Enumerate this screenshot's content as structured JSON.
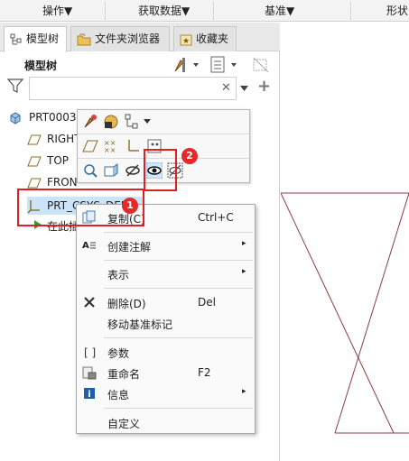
{
  "ribbon": {
    "tabs": [
      {
        "label": "操作▼"
      },
      {
        "label": "获取数据▼"
      },
      {
        "label": "基准▼"
      },
      {
        "label": "形状"
      }
    ]
  },
  "panel_tabs": [
    {
      "label": "模型树",
      "icon": "model-tree-icon"
    },
    {
      "label": "文件夹浏览器",
      "icon": "folder-icon"
    },
    {
      "label": "收藏夹",
      "icon": "favorites-icon"
    }
  ],
  "model_tree": {
    "title": "模型树",
    "search_placeholder": "",
    "items": [
      {
        "label": "PRT0003.",
        "icon": "part-icon"
      },
      {
        "label": "RIGHT",
        "icon": "datum-plane-icon"
      },
      {
        "label": "TOP",
        "icon": "datum-plane-icon"
      },
      {
        "label": "FRON",
        "icon": "datum-plane-icon"
      },
      {
        "label": "PRT_CSYS_DEF",
        "icon": "csys-icon"
      },
      {
        "label": "在此插",
        "icon": "insert-here-icon"
      }
    ]
  },
  "context_menu": {
    "items": [
      {
        "label": "复制(C)",
        "shortcut": "Ctrl+C",
        "icon": "copy-icon"
      },
      {
        "label": "创建注解",
        "submenu": "▸",
        "icon": "annotation-icon"
      },
      {
        "label": "表示",
        "submenu": "▸"
      },
      {
        "label": "删除(D)",
        "shortcut": "Del",
        "icon": "delete-icon"
      },
      {
        "label": "移动基准标记"
      },
      {
        "label": "参数",
        "icon": "parameters-icon"
      },
      {
        "label": "重命名",
        "shortcut": "F2",
        "icon": "rename-icon"
      },
      {
        "label": "信息",
        "submenu": "▸",
        "icon": "info-icon"
      },
      {
        "label": "自定义"
      }
    ]
  },
  "annotations": {
    "badge1": "1",
    "badge2": "2"
  },
  "colors": {
    "highlight": "#e02020",
    "selection": "#cce4f7",
    "graphics_lines": "#8a3d4a"
  }
}
